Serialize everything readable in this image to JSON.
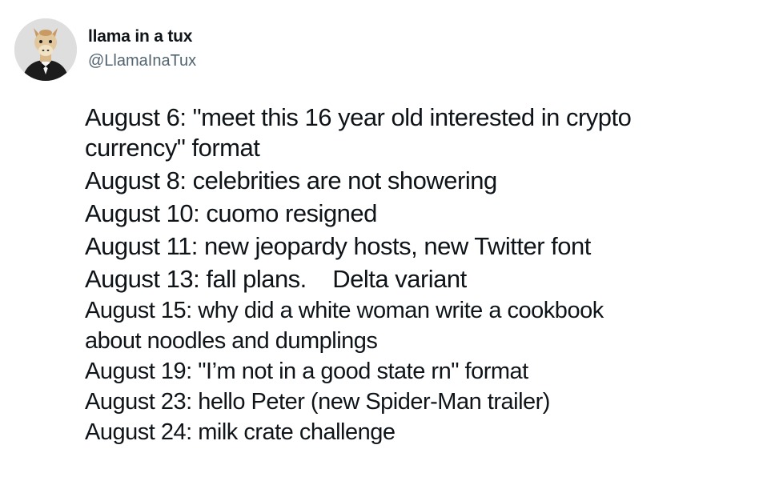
{
  "author": {
    "display_name": "llama in a tux",
    "handle": "@LlamaInaTux",
    "avatar_icon": "llama-in-tuxedo-avatar"
  },
  "tweet": {
    "lines": [
      "August 6: \"meet this 16 year old interested in crypto",
      "currency\" format",
      "August 8: celebrities are not showering",
      "August 10: cuomo resigned",
      "August 11: new jeopardy hosts, new Twitter font",
      "August 13: fall plans.    Delta variant",
      "August 15: why did a white woman write a cookbook",
      "about noodles and dumplings",
      "August 19: \"I’m not in a good state rn\" format",
      "August 23: hello Peter (new Spider-Man trailer)",
      "August 24: milk crate challenge"
    ]
  },
  "colors": {
    "text": "#0f1419",
    "secondary_text": "#536471",
    "background": "#ffffff"
  }
}
